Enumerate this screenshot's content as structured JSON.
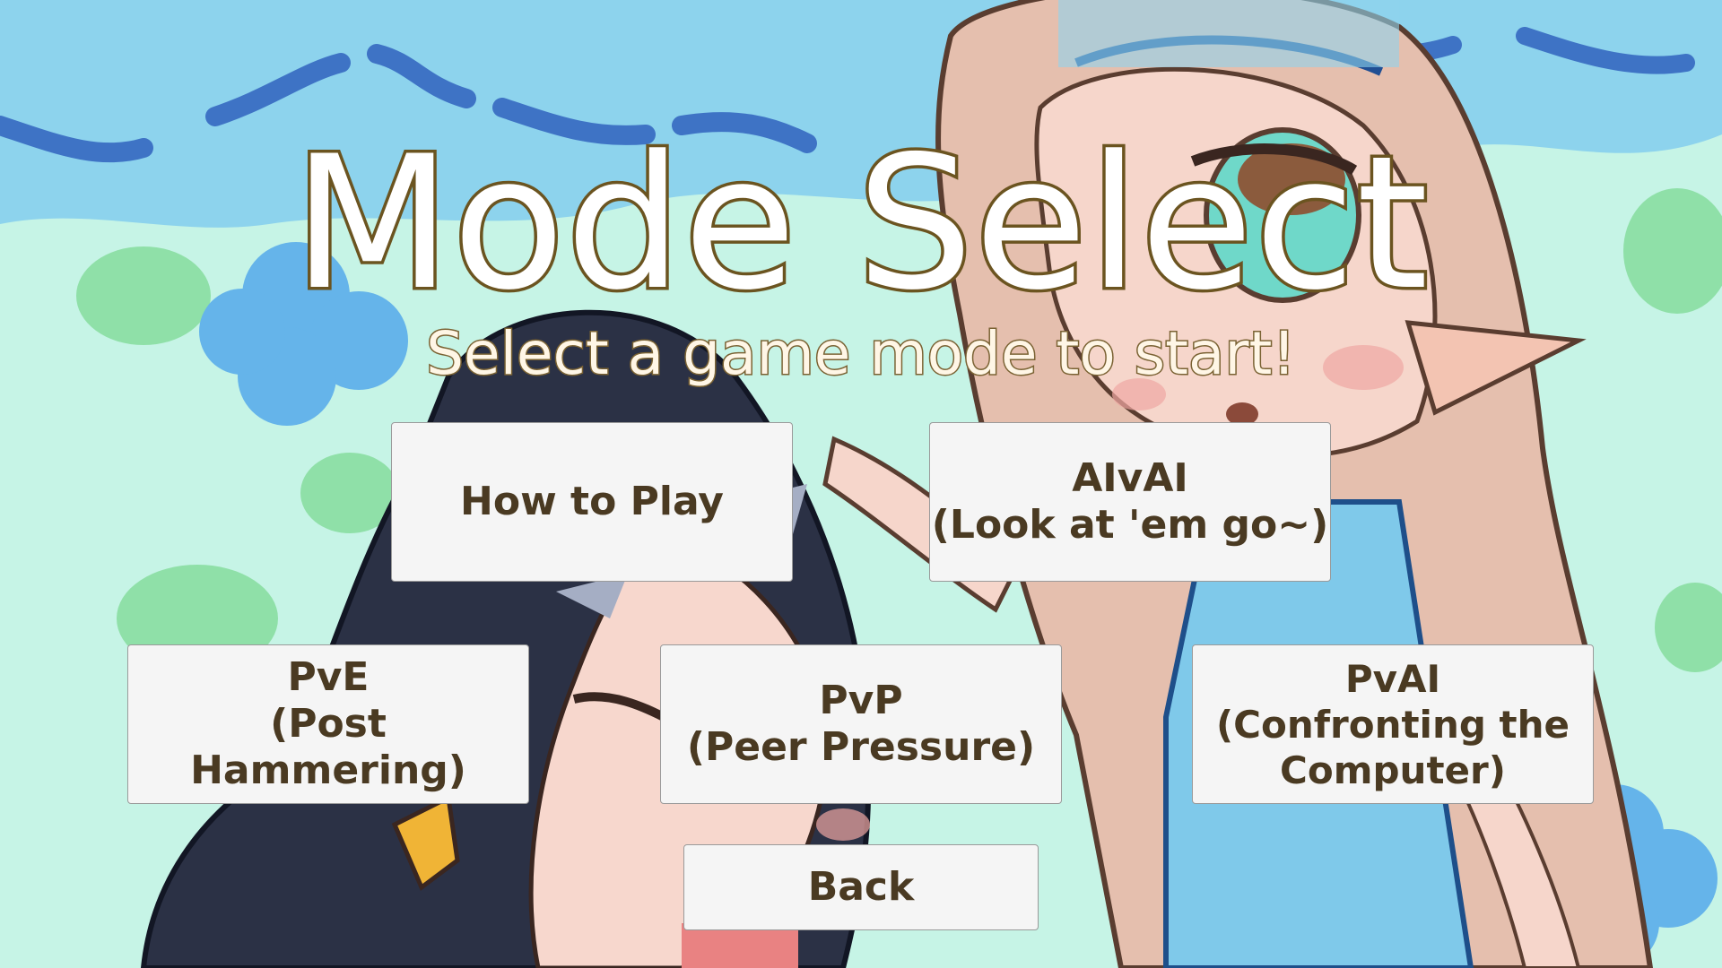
{
  "screen": {
    "title": "Mode Select",
    "subtitle": "Select a game mode to start!"
  },
  "buttons": {
    "how_to_play": "How to Play",
    "aivai": "AIvAI\n(Look at 'em go~)",
    "pve": "PvE\n(Post Hammering)",
    "pvp": "PvP\n(Peer Pressure)",
    "pvai": "PvAI\n(Confronting the\nComputer)",
    "back": "Back"
  },
  "colors": {
    "sky": "#8fd3ec",
    "grass": "#c6f4e6",
    "title_outline": "#6b5420",
    "button_bg": "#f5f5f5",
    "button_text": "#4a3a22"
  }
}
